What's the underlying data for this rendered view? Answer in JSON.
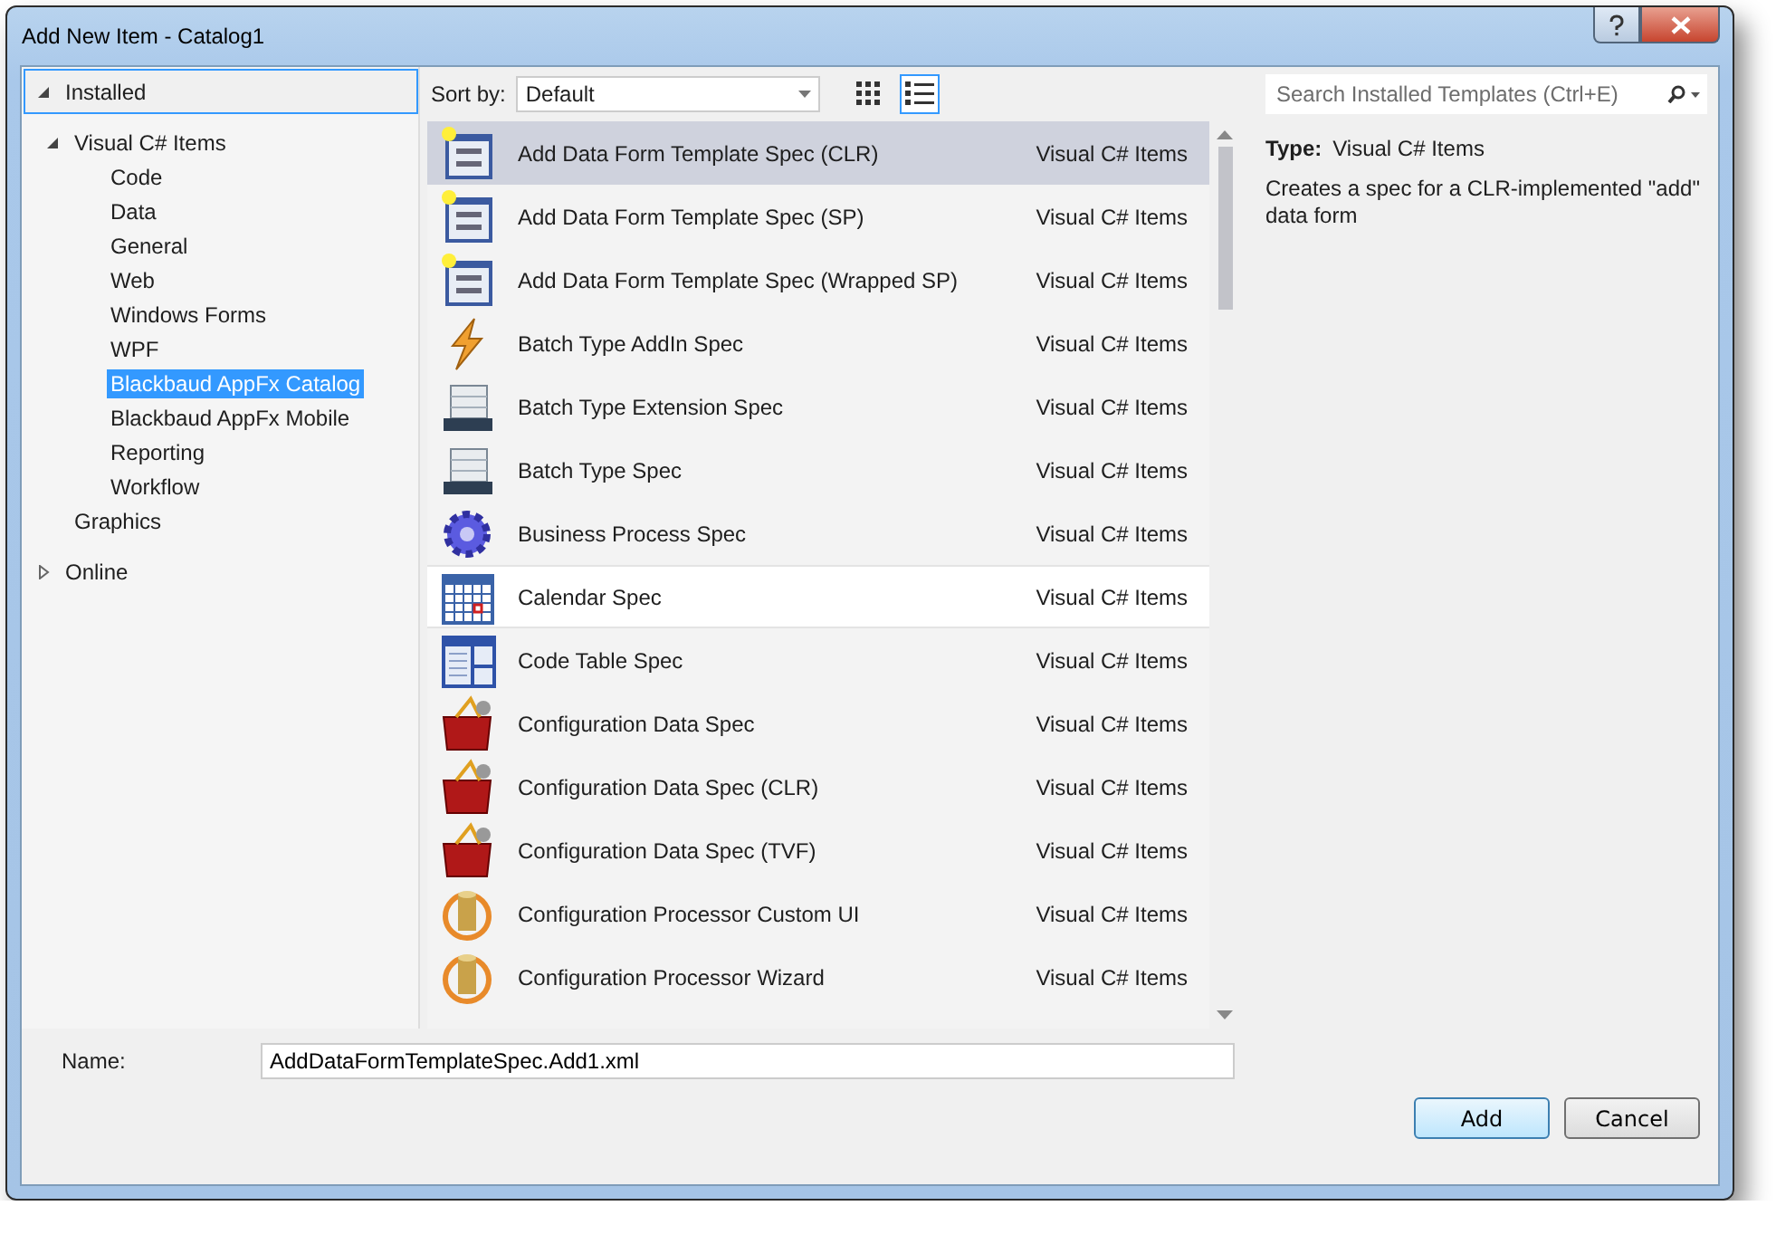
{
  "window": {
    "title": "Add New Item - Catalog1"
  },
  "sections": [
    {
      "label": "Installed",
      "expanded": true,
      "selected": true
    },
    {
      "label": "Online",
      "expanded": false,
      "selected": false
    }
  ],
  "tree": [
    {
      "label": "Visual C# Items",
      "expanded": true,
      "selected": false,
      "children": [
        {
          "label": "Code",
          "selected": false
        },
        {
          "label": "Data",
          "selected": false
        },
        {
          "label": "General",
          "selected": false
        },
        {
          "label": "Web",
          "selected": false
        },
        {
          "label": "Windows Forms",
          "selected": false
        },
        {
          "label": "WPF",
          "selected": false
        },
        {
          "label": "Blackbaud AppFx Catalog",
          "selected": true
        },
        {
          "label": "Blackbaud AppFx Mobile",
          "selected": false
        },
        {
          "label": "Reporting",
          "selected": false
        },
        {
          "label": "Workflow",
          "selected": false
        }
      ]
    },
    {
      "label": "Graphics",
      "selected": false
    }
  ],
  "sort": {
    "label": "Sort by:",
    "value": "Default"
  },
  "view_modes": [
    {
      "kind": "grid",
      "selected": false
    },
    {
      "kind": "list",
      "selected": true
    }
  ],
  "search": {
    "placeholder": "Search Installed Templates (Ctrl+E)"
  },
  "templates": [
    {
      "name": "Add Data Form Template Spec (CLR)",
      "type": "Visual C# Items",
      "kind": "form",
      "selected": true,
      "hovered": false
    },
    {
      "name": "Add Data Form Template Spec (SP)",
      "type": "Visual C# Items",
      "kind": "form",
      "selected": false,
      "hovered": false
    },
    {
      "name": "Add Data Form Template Spec (Wrapped SP)",
      "type": "Visual C# Items",
      "kind": "form",
      "selected": false,
      "hovered": false
    },
    {
      "name": "Batch Type AddIn Spec",
      "type": "Visual C# Items",
      "kind": "lightning",
      "selected": false,
      "hovered": false
    },
    {
      "name": "Batch Type Extension Spec",
      "type": "Visual C# Items",
      "kind": "batch",
      "selected": false,
      "hovered": false
    },
    {
      "name": "Batch Type Spec",
      "type": "Visual C# Items",
      "kind": "batch",
      "selected": false,
      "hovered": false
    },
    {
      "name": "Business Process Spec",
      "type": "Visual C# Items",
      "kind": "gear",
      "selected": false,
      "hovered": false
    },
    {
      "name": "Calendar Spec",
      "type": "Visual C# Items",
      "kind": "calendar",
      "selected": false,
      "hovered": true
    },
    {
      "name": "Code Table Spec",
      "type": "Visual C# Items",
      "kind": "codetable",
      "selected": false,
      "hovered": false
    },
    {
      "name": "Configuration Data Spec",
      "type": "Visual C# Items",
      "kind": "toolbox",
      "selected": false,
      "hovered": false
    },
    {
      "name": "Configuration Data Spec (CLR)",
      "type": "Visual C# Items",
      "kind": "toolbox",
      "selected": false,
      "hovered": false
    },
    {
      "name": "Configuration Data Spec (TVF)",
      "type": "Visual C# Items",
      "kind": "toolbox",
      "selected": false,
      "hovered": false
    },
    {
      "name": "Configuration Processor Custom UI",
      "type": "Visual C# Items",
      "kind": "processor",
      "selected": false,
      "hovered": false
    },
    {
      "name": "Configuration Processor Wizard",
      "type": "Visual C# Items",
      "kind": "processor",
      "selected": false,
      "hovered": false
    }
  ],
  "details": {
    "type_label": "Type:",
    "type_value": "Visual C# Items",
    "description": "Creates a spec for a CLR-implemented \"add\" data form"
  },
  "name_field": {
    "label": "Name:",
    "value": "AddDataFormTemplateSpec.Add1.xml"
  },
  "buttons": [
    {
      "label": "Add",
      "default": true
    },
    {
      "label": "Cancel",
      "default": false
    }
  ]
}
